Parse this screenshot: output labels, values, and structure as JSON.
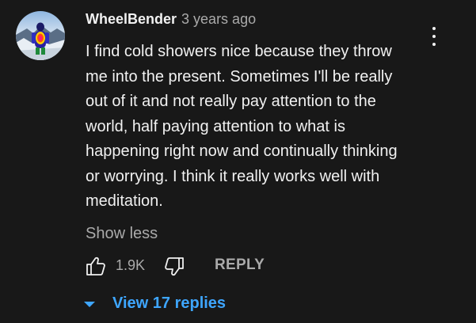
{
  "comment": {
    "author": "WheelBender",
    "timestamp": "3 years ago",
    "text": "I find cold showers nice because they throw me into the present. Sometimes I'll be really out of it and not really pay attention to the world, half paying attention to what is happening right now and continually thinking or worrying. I think it really works well with meditation.",
    "show_less_label": "Show less",
    "avatar_icon": "user-avatar-icon",
    "menu_icon": "more-vert-icon"
  },
  "actions": {
    "like_icon": "thumbs-up-icon",
    "like_count": "1.9K",
    "dislike_icon": "thumbs-down-icon",
    "reply_label": "REPLY"
  },
  "replies": {
    "toggle_icon": "caret-down-icon",
    "label": "View 17 replies"
  },
  "colors": {
    "background": "#181818",
    "text_primary": "#f1f1f1",
    "text_secondary": "#aaaaaa",
    "link_blue": "#3ea6ff"
  }
}
